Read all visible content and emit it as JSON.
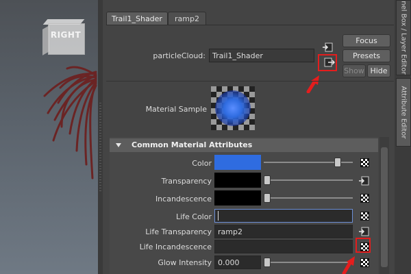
{
  "viewport": {
    "cube_label": "RIGHT"
  },
  "tabs": [
    "Trail1_Shader",
    "ramp2"
  ],
  "node": {
    "label": "particleCloud:",
    "value": "Trail1_Shader"
  },
  "buttons": {
    "focus": "Focus",
    "presets": "Presets",
    "show": "Show",
    "hide": "Hide"
  },
  "material_sample_label": "Material Sample",
  "section_title": "Common Material Attributes",
  "side_tabs": {
    "channel_box": "nel Box / Layer Editor",
    "attribute_editor": "Attribute Editor"
  },
  "attributes": [
    {
      "label": "Color",
      "swatch": "#2f6ce0",
      "slider": 0.93
    },
    {
      "label": "Transparency",
      "swatch": "#000000",
      "slider": 0.0
    },
    {
      "label": "Incandescence",
      "swatch": "#000000",
      "slider": 0.0
    },
    {
      "label": "Life Color",
      "value": ""
    },
    {
      "label": "Life Transparency",
      "value": "ramp2"
    },
    {
      "label": "Life Incandescence",
      "value": ""
    },
    {
      "label": "Glow Intensity",
      "value": "0.000",
      "slider": 0.0
    }
  ],
  "colors": {
    "highlight": "#e51d1d",
    "accent": "#2f6ce0"
  }
}
